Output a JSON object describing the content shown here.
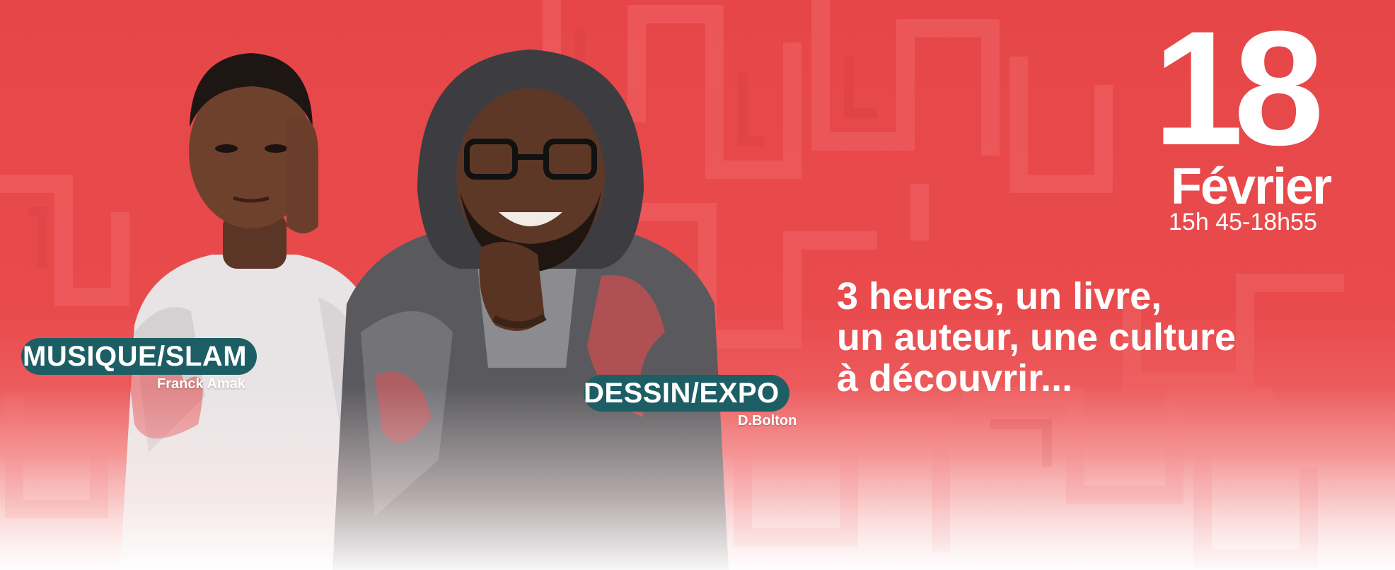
{
  "event": {
    "day": "18",
    "month": "Février",
    "time": "15h 45-18h55"
  },
  "tagline": {
    "line1": "3 heures, un livre,",
    "line2": "un auteur, une culture",
    "line3": "à découvrir..."
  },
  "performers": [
    {
      "category": "MUSIQUE/SLAM",
      "name": "Franck Amak"
    },
    {
      "category": "DESSIN/EXPO",
      "name": "D.Bolton"
    }
  ],
  "colors": {
    "background": "#e84a4c",
    "tag": "#1d5e64",
    "text": "#ffffff"
  },
  "icons": {
    "left_portrait": "person-portrait-icon",
    "right_portrait": "person-portrait-icon"
  }
}
